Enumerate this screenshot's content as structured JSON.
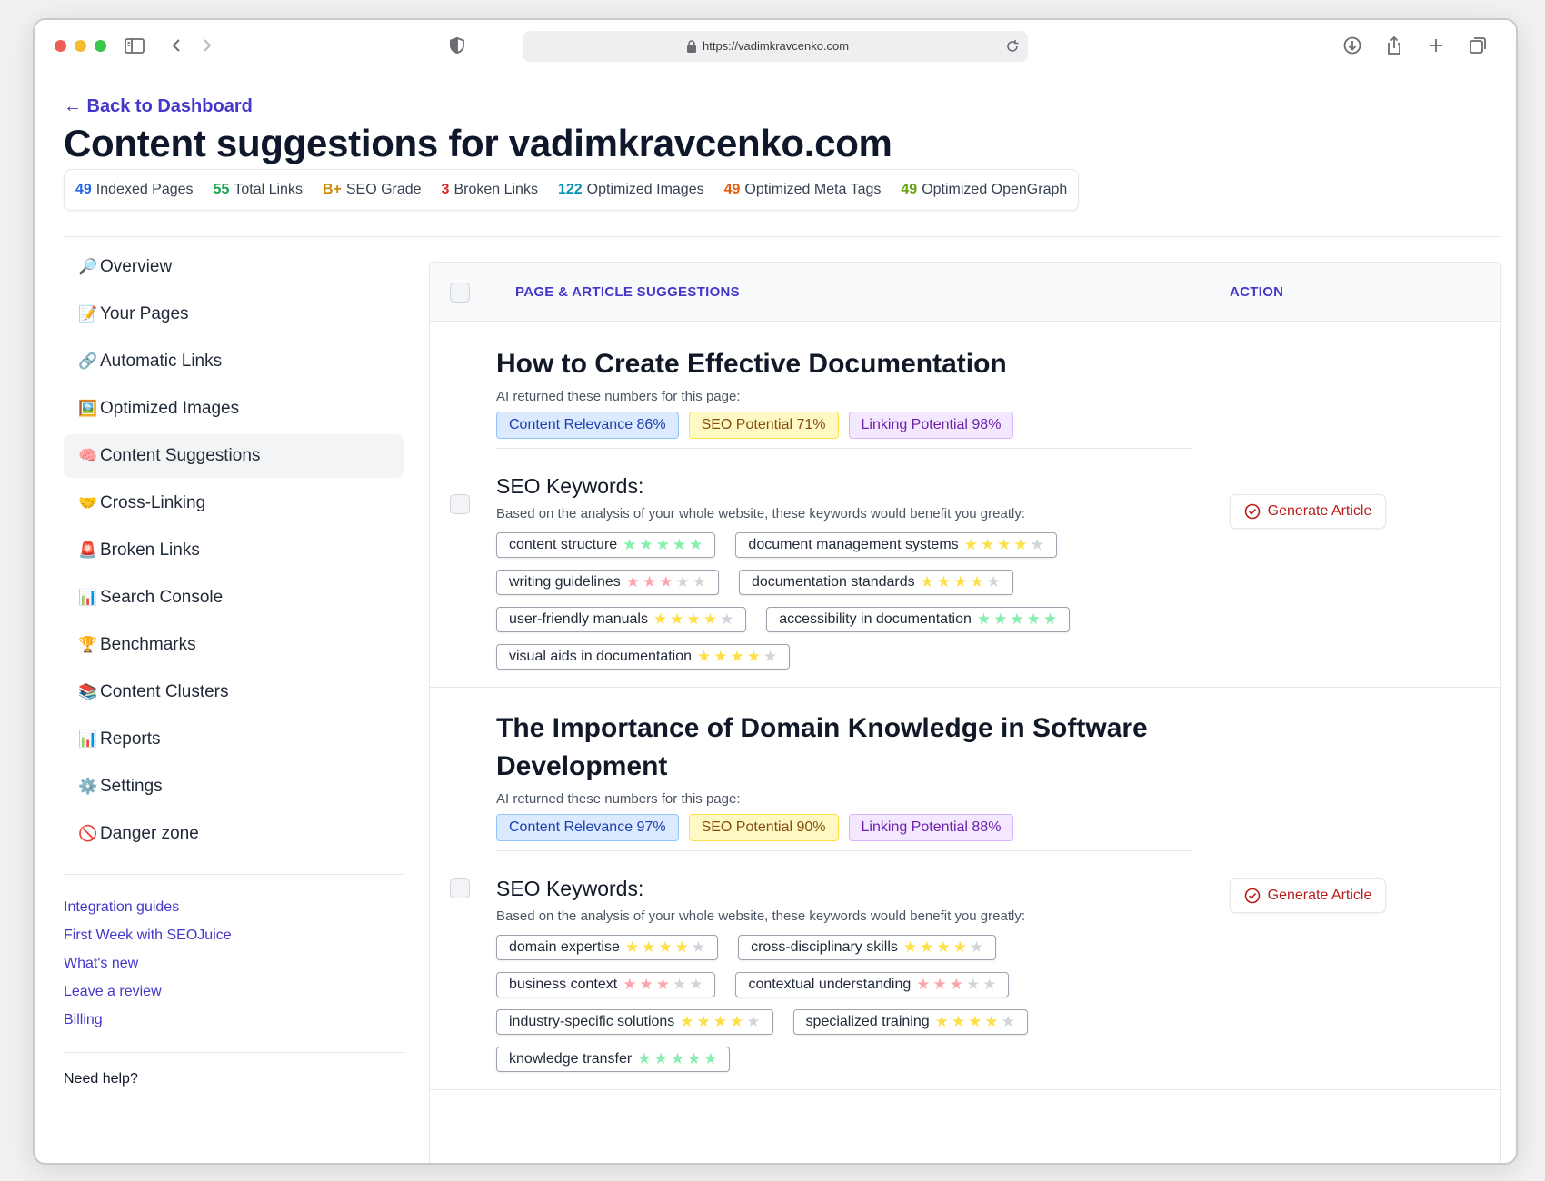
{
  "browser": {
    "url": "https://vadimkravcenko.com"
  },
  "header": {
    "back_label": "← Back to Dashboard",
    "title": "Content suggestions for vadimkravcenko.com"
  },
  "stats": [
    {
      "value": "49",
      "label": "Indexed Pages",
      "color": "#2563eb"
    },
    {
      "value": "55",
      "label": "Total Links",
      "color": "#16a34a"
    },
    {
      "value": "B+",
      "label": "SEO Grade",
      "color": "#ca8a04"
    },
    {
      "value": "3",
      "label": "Broken Links",
      "color": "#dc2626"
    },
    {
      "value": "122",
      "label": "Optimized Images",
      "color": "#0891b2"
    },
    {
      "value": "49",
      "label": "Optimized Meta Tags",
      "color": "#ea580c"
    },
    {
      "value": "49",
      "label": "Optimized OpenGraph",
      "color": "#65a30d"
    }
  ],
  "sidebar": {
    "items": [
      {
        "emoji": "🔎",
        "label": "Overview",
        "active": false
      },
      {
        "emoji": "📝",
        "label": "Your Pages",
        "active": false
      },
      {
        "emoji": "🔗",
        "label": "Automatic Links",
        "active": false
      },
      {
        "emoji": "🖼️",
        "label": "Optimized Images",
        "active": false
      },
      {
        "emoji": "🧠",
        "label": "Content Suggestions",
        "active": true
      },
      {
        "emoji": "🤝",
        "label": "Cross-Linking",
        "active": false
      },
      {
        "emoji": "🚨",
        "label": "Broken Links",
        "active": false
      },
      {
        "emoji": "📊",
        "label": "Search Console",
        "active": false
      },
      {
        "emoji": "🏆",
        "label": "Benchmarks",
        "active": false
      },
      {
        "emoji": "📚",
        "label": "Content Clusters",
        "active": false
      },
      {
        "emoji": "📊",
        "label": "Reports",
        "active": false
      },
      {
        "emoji": "⚙️",
        "label": "Settings",
        "active": false
      },
      {
        "emoji": "🚫",
        "label": "Danger zone",
        "active": false
      }
    ],
    "links": [
      "Integration guides",
      "First Week with SEOJuice",
      "What's new",
      "Leave a review",
      "Billing"
    ],
    "need_help": "Need help?"
  },
  "table": {
    "col_suggestions": "PAGE & ARTICLE SUGGESTIONS",
    "col_action": "ACTION",
    "ai_note": "AI returned these numbers for this page:",
    "kw_heading": "SEO Keywords:",
    "kw_subtitle": "Based on the analysis of your whole website, these keywords would benefit you greatly:",
    "action_label": "Generate Article",
    "rows": [
      {
        "title": "How to Create Effective Documentation",
        "metrics": {
          "relevance": "Content Relevance 86%",
          "seo": "SEO Potential 71%",
          "linking": "Linking Potential 98%"
        },
        "keywords": [
          {
            "text": "content structure",
            "stars": 5
          },
          {
            "text": "document management systems",
            "stars": 4
          },
          {
            "text": "writing guidelines",
            "stars": 3
          },
          {
            "text": "documentation standards",
            "stars": 4
          },
          {
            "text": "user-friendly manuals",
            "stars": 4
          },
          {
            "text": "accessibility in documentation",
            "stars": 5
          },
          {
            "text": "visual aids in documentation",
            "stars": 4
          }
        ]
      },
      {
        "title": "The Importance of Domain Knowledge in Software Development",
        "metrics": {
          "relevance": "Content Relevance 97%",
          "seo": "SEO Potential 90%",
          "linking": "Linking Potential 88%"
        },
        "keywords": [
          {
            "text": "domain expertise",
            "stars": 4
          },
          {
            "text": "cross-disciplinary skills",
            "stars": 4
          },
          {
            "text": "business context",
            "stars": 3
          },
          {
            "text": "contextual understanding",
            "stars": 3
          },
          {
            "text": "industry-specific solutions",
            "stars": 4
          },
          {
            "text": "specialized training",
            "stars": 4
          },
          {
            "text": "knowledge transfer",
            "stars": 5
          }
        ]
      }
    ]
  }
}
